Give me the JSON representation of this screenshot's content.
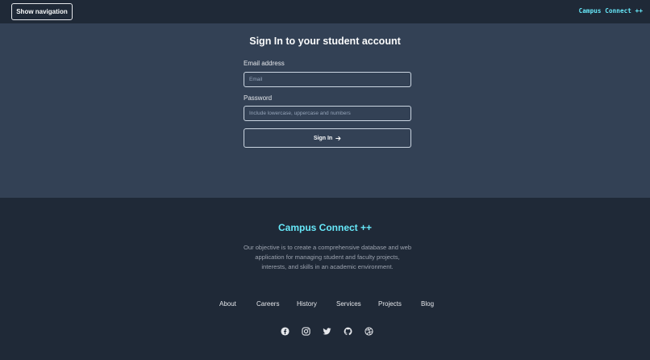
{
  "header": {
    "nav_toggle_label": "Show navigation",
    "brand": "Campus Connect ++"
  },
  "signin": {
    "title": "Sign In to your student account",
    "email_label": "Email address",
    "email_placeholder": "Email",
    "email_value": "",
    "password_label": "Password",
    "password_placeholder": "Include lowercase, uppercase and numbers",
    "password_value": "",
    "submit_label": "Sign In"
  },
  "footer": {
    "brand": "Campus Connect ++",
    "description": "Our objective is to create a comprehensive database and web application for managing student and faculty projects, interests, and skills in an academic environment.",
    "links": [
      "About",
      "Careers",
      "History",
      "Services",
      "Projects",
      "Blog"
    ],
    "social_icons": [
      "facebook-icon",
      "instagram-icon",
      "twitter-icon",
      "github-icon",
      "dribbble-icon"
    ]
  },
  "colors": {
    "accent": "#67e8f9",
    "header_bg": "#1f2937",
    "main_bg": "#334155",
    "footer_bg": "#1f2937"
  }
}
